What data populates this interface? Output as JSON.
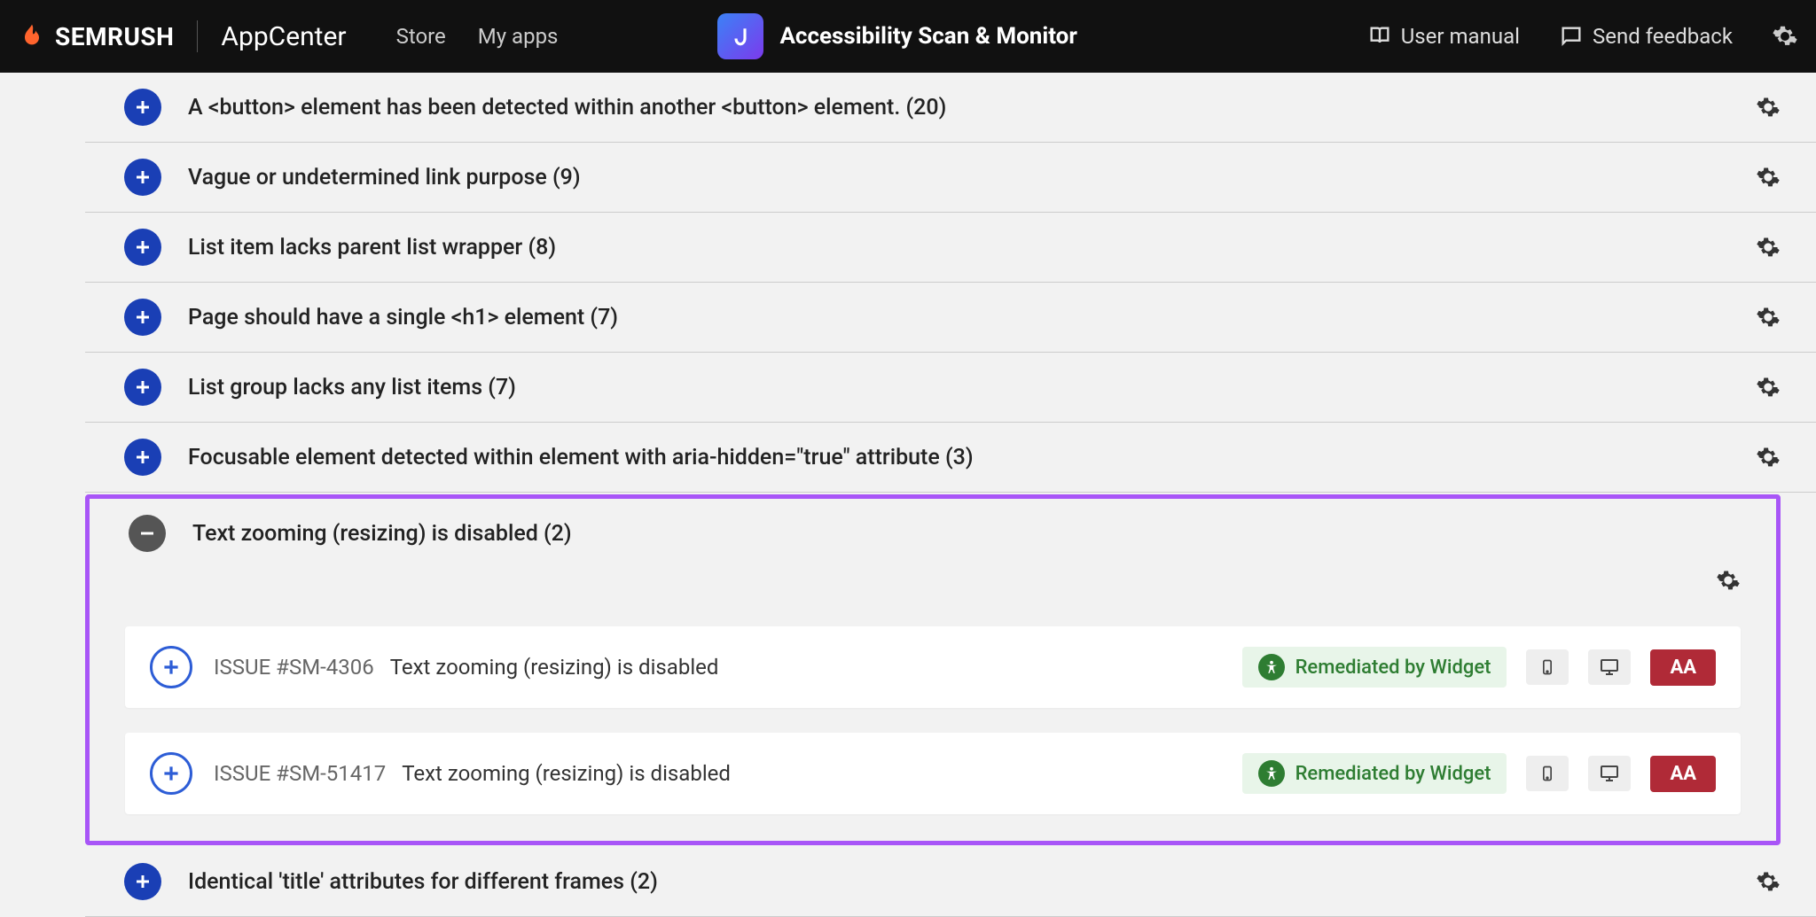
{
  "header": {
    "brand": "SEMRUSH",
    "appcenter": "AppCenter",
    "nav": {
      "store": "Store",
      "myapps": "My apps"
    },
    "app_title": "Accessibility Scan & Monitor",
    "user_manual": "User manual",
    "send_feedback": "Send feedback"
  },
  "issues": [
    {
      "title": "A <button> element has been detected within another <button> element. (20)"
    },
    {
      "title": "Vague or undetermined link purpose (9)"
    },
    {
      "title": "List item lacks parent list wrapper (8)"
    },
    {
      "title": "Page should have a single <h1> element (7)"
    },
    {
      "title": "List group lacks any list items (7)"
    },
    {
      "title": "Focusable element detected within element with aria-hidden=\"true\" attribute (3)"
    }
  ],
  "expanded": {
    "title": "Text zooming (resizing) is disabled (2)",
    "items": [
      {
        "id": "ISSUE #SM-4306",
        "desc": "Text zooming (resizing) is disabled",
        "badge": "Remediated by Widget",
        "level": "AA"
      },
      {
        "id": "ISSUE #SM-51417",
        "desc": "Text zooming (resizing) is disabled",
        "badge": "Remediated by Widget",
        "level": "AA"
      }
    ]
  },
  "after": {
    "title": "Identical 'title' attributes for different frames (2)"
  }
}
